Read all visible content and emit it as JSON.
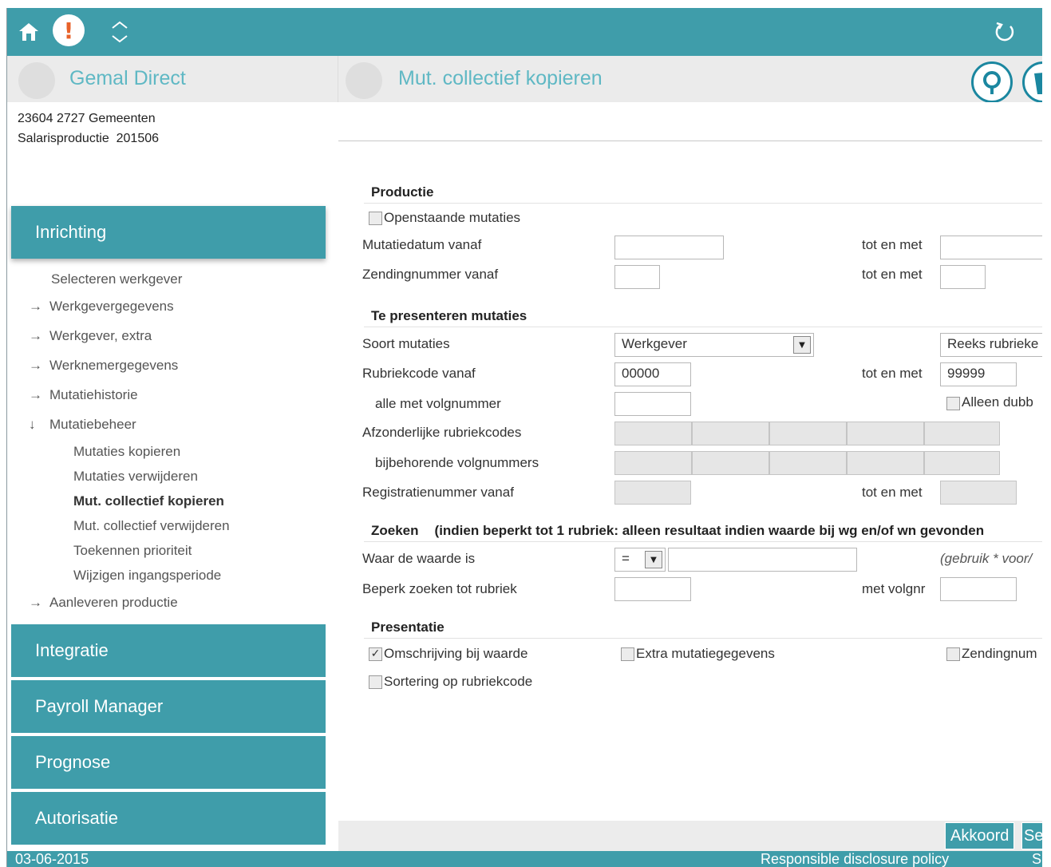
{
  "header": {
    "left_title": "Gemal Direct",
    "page_title": "Mut. collectief kopieren"
  },
  "company": {
    "line1": "23604 2727 Gemeenten",
    "line2": "Salarisproductie  201506"
  },
  "sidebar": {
    "sections": [
      {
        "label": "Inrichting"
      },
      {
        "label": "Integratie"
      },
      {
        "label": "Payroll Manager"
      },
      {
        "label": "Prognose"
      },
      {
        "label": "Autorisatie"
      }
    ],
    "items": [
      {
        "label": "Selecteren werkgever",
        "arrow": ""
      },
      {
        "label": "Werkgevergegevens",
        "arrow": "→"
      },
      {
        "label": "Werkgever, extra",
        "arrow": "→"
      },
      {
        "label": "Werknemergegevens",
        "arrow": "→"
      },
      {
        "label": "Mutatiehistorie",
        "arrow": "→"
      },
      {
        "label": "Mutatiebeheer",
        "arrow": "↓"
      },
      {
        "label": "Mutaties kopieren",
        "arrow": ""
      },
      {
        "label": "Mutaties verwijderen",
        "arrow": ""
      },
      {
        "label": "Mut. collectief kopieren",
        "arrow": ""
      },
      {
        "label": "Mut. collectief verwijderen",
        "arrow": ""
      },
      {
        "label": "Toekennen prioriteit",
        "arrow": ""
      },
      {
        "label": "Wijzigen ingangsperiode",
        "arrow": ""
      },
      {
        "label": "Aanleveren productie",
        "arrow": "→"
      }
    ]
  },
  "form": {
    "productie": {
      "heading": "Productie",
      "openstaande_label": "Openstaande mutaties",
      "mutatiedatum_label": "Mutatiedatum vanaf",
      "zendingnummer_label": "Zendingnummer vanaf",
      "tot_en_met": "tot en met"
    },
    "presenteren": {
      "heading": "Te presenteren mutaties",
      "soort_label": "Soort mutaties",
      "soort_value": "Werkgever",
      "reeks_value": "Reeks rubrieke",
      "rubriekcode_label": "Rubriekcode vanaf",
      "rubriekcode_from": "00000",
      "rubriekcode_to": "99999",
      "tot_en_met": "tot en met",
      "volgnummer_label": "alle met volgnummer",
      "alleen_label": "Alleen dubb",
      "afzonderlijke_label": "Afzonderlijke rubriekcodes",
      "bijbehorende_label": "bijbehorende volgnummers",
      "registratie_label": "Registratienummer vanaf"
    },
    "zoeken": {
      "heading": "Zoeken",
      "note": "(indien beperkt tot 1 rubriek: alleen resultaat indien waarde bij wg en/of wn gevonden",
      "waar_label": "Waar de waarde is",
      "operator_value": "=",
      "hint": "(gebruik * voor/",
      "beperk_label": "Beperk zoeken tot rubriek",
      "volgnr_label": "met volgnr"
    },
    "presentatie": {
      "heading": "Presentatie",
      "omschrijving_label": "Omschrijving bij waarde",
      "extra_label": "Extra mutatiegegevens",
      "zending_label": "Zendingnum",
      "sortering_label": "Sortering op rubriekcode"
    }
  },
  "actions": {
    "akkoord": "Akkoord",
    "second": "Se"
  },
  "footer": {
    "date": "03-06-2015",
    "policy": "Responsible disclosure policy",
    "more": "S"
  }
}
